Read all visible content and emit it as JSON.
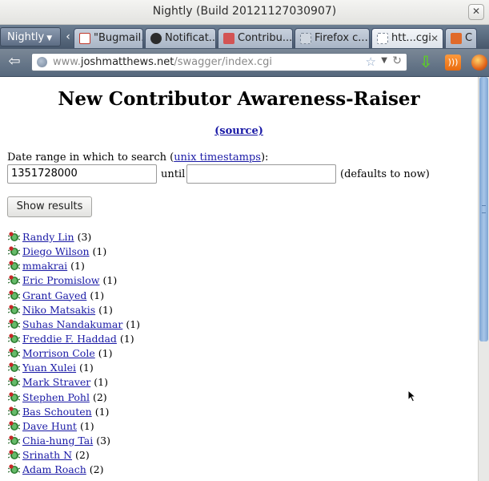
{
  "window": {
    "title": "Nightly (Build 20121127030907)",
    "close_glyph": "✕"
  },
  "tabs": {
    "menu_label": "Nightly",
    "items": [
      {
        "label": "\"Bugmail...",
        "icon_color": "#c0392b"
      },
      {
        "label": "Notificat...",
        "icon_color": "#2b2b2b"
      },
      {
        "label": "Contribu...",
        "icon_color": "#d35454"
      },
      {
        "label": "Firefox c...",
        "icon_color": "#cfd6df"
      },
      {
        "label": "htt...cgi",
        "icon_color": "#ffffff"
      },
      {
        "label": "C",
        "icon_color": "#e06a2a"
      }
    ]
  },
  "urlbar": {
    "prefix": "www.",
    "domain": "joshmatthews.net",
    "path": "/swagger/index.cgi"
  },
  "page": {
    "title": "New Contributor Awareness-Raiser",
    "source_link": "(source)",
    "date_label_prefix": "Date range in which to search (",
    "date_label_link": "unix timestamps",
    "date_label_suffix": "):",
    "start_value": "1351728000",
    "end_value": "",
    "until_label": "until",
    "defaults_note": "(defaults to now)",
    "submit_label": "Show results"
  },
  "results": [
    {
      "name": "Randy Lin",
      "count": "(3)"
    },
    {
      "name": "Diego Wilson",
      "count": "(1)"
    },
    {
      "name": "mmakrai",
      "count": "(1)"
    },
    {
      "name": "Eric Promislow",
      "count": "(1)"
    },
    {
      "name": "Grant Gayed",
      "count": "(1)"
    },
    {
      "name": "Niko Matsakis",
      "count": "(1)"
    },
    {
      "name": "Suhas Nandakumar",
      "count": "(1)"
    },
    {
      "name": "Freddie F. Haddad",
      "count": "(1)"
    },
    {
      "name": "Morrison Cole",
      "count": "(1)"
    },
    {
      "name": "Yuan Xulei",
      "count": "(1)"
    },
    {
      "name": "Mark Straver",
      "count": "(1)"
    },
    {
      "name": "Stephen Pohl",
      "count": "(2)"
    },
    {
      "name": "Bas Schouten",
      "count": "(1)"
    },
    {
      "name": "Dave Hunt",
      "count": "(1)"
    },
    {
      "name": "Chia-hung Tai",
      "count": "(3)"
    },
    {
      "name": "Srinath N",
      "count": "(2)"
    },
    {
      "name": "Adam Roach",
      "count": "(2)"
    }
  ],
  "colors": {
    "link": "#1a1aa6",
    "scroll_thumb": "#7da4d3",
    "tab_strip": "#47576b"
  },
  "icons": {
    "result_icon": "bug-icon",
    "download": "download-arrow-icon",
    "feed": "rss-icon",
    "browser": "firefox-icon"
  }
}
